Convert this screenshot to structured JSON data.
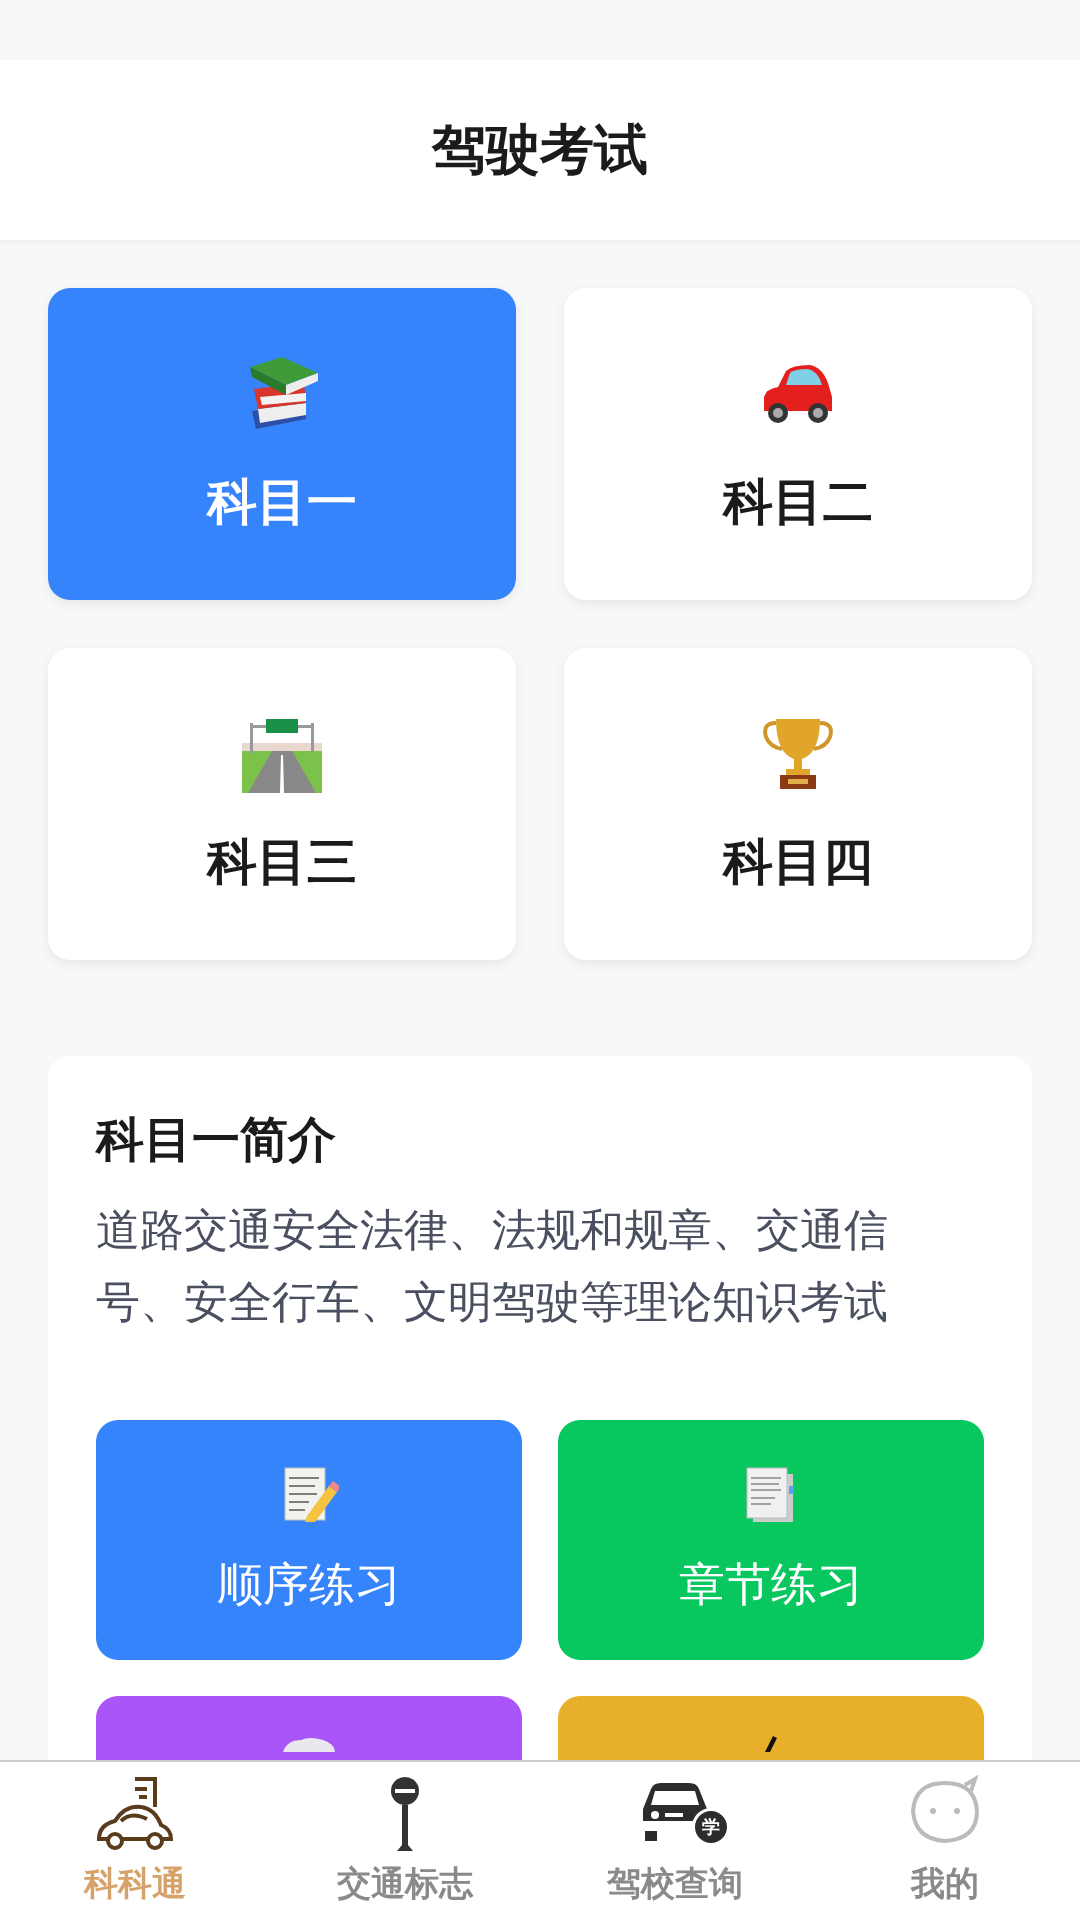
{
  "header": {
    "title": "驾驶考试"
  },
  "subjects": [
    {
      "label": "科目一",
      "kind": "books",
      "selected": true
    },
    {
      "label": "科目二",
      "kind": "car",
      "selected": false
    },
    {
      "label": "科目三",
      "kind": "road",
      "selected": false
    },
    {
      "label": "科目四",
      "kind": "trophy",
      "selected": false
    }
  ],
  "intro": {
    "title": "科目一简介",
    "text": "道路交通安全法律、法规和规章、交通信号、安全行车、文明驾驶等理论知识考试"
  },
  "practice": [
    {
      "label": "顺序练习",
      "kind": "memo",
      "color": "#3584fb"
    },
    {
      "label": "章节练习",
      "kind": "document",
      "color": "#08c75f"
    },
    {
      "kind": "cloud",
      "color": "#aa55f8"
    },
    {
      "kind": "pen",
      "color": "#e8b02a"
    }
  ],
  "tabs": [
    {
      "label": "科科通",
      "kind": "home",
      "selected": true
    },
    {
      "label": "交通标志",
      "kind": "signs",
      "selected": false
    },
    {
      "label": "驾校查询",
      "kind": "schools",
      "badge": "学",
      "selected": false
    },
    {
      "label": "我的",
      "kind": "profile",
      "selected": false
    }
  ]
}
